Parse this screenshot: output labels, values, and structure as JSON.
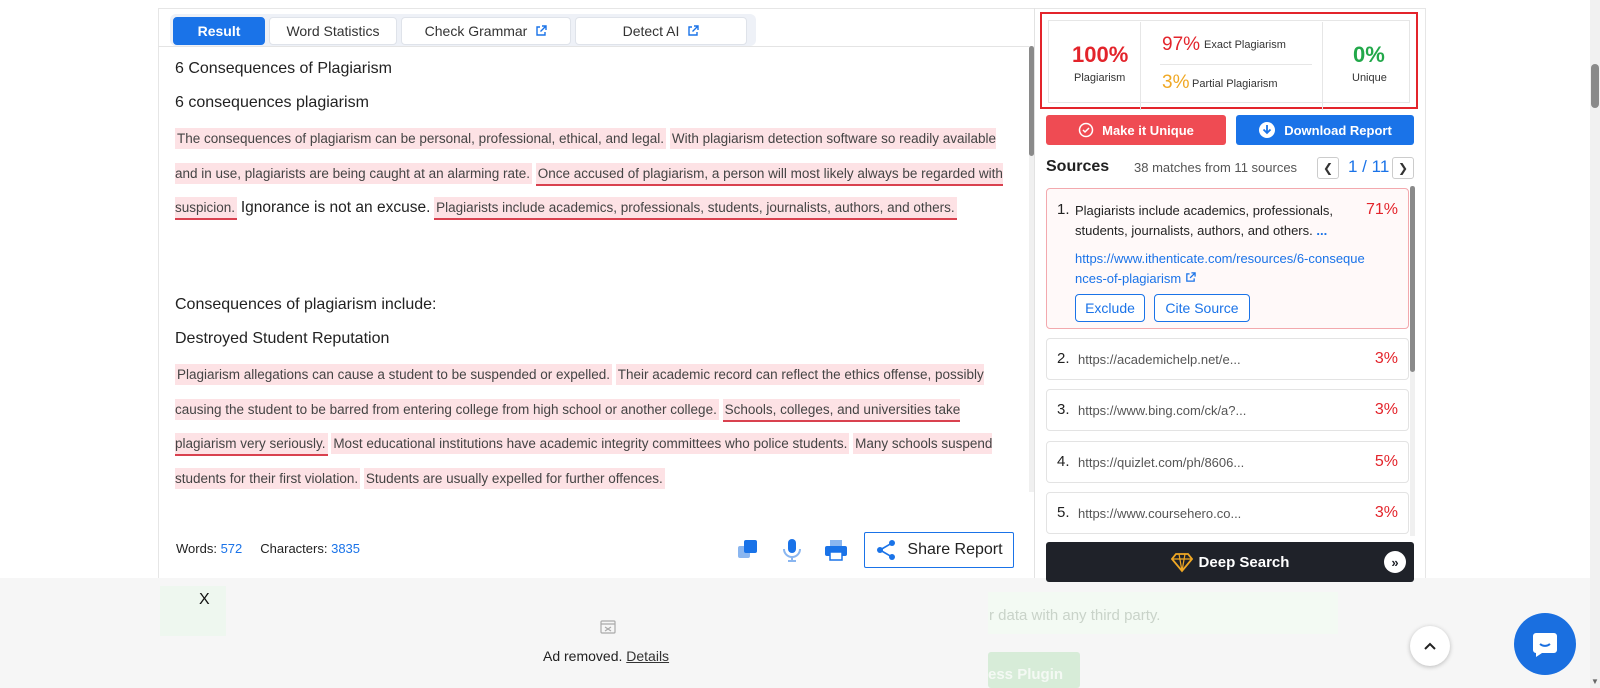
{
  "tabs": [
    {
      "label": "Result"
    },
    {
      "label": "Word Statistics"
    },
    {
      "label": "Check Grammar"
    },
    {
      "label": "Detect AI"
    }
  ],
  "content": {
    "heading1": "6 Consequences of Plagiarism",
    "heading2": "6 consequences plagiarism",
    "p1": {
      "s1": "The consequences of plagiarism can be personal, professional, ethical, and legal.",
      "s2": "With plagiarism detection software so readily available and in use, plagiarists are being caught at an alarming rate.",
      "s3": "Once accused of plagiarism, a person will most likely always be regarded with suspicion.",
      "s4": "Ignorance is not an excuse.",
      "s5": "Plagiarists include academics, professionals, students, journalists, authors, and others."
    },
    "heading3": "Consequences of plagiarism include:",
    "heading4": "Destroyed Student Reputation",
    "p2": {
      "s1": "Plagiarism allegations can cause a student to be suspended or expelled.",
      "s2": "Their academic record can reflect the ethics offense, possibly causing the student to be barred from entering college from high school or another college.",
      "s3": "Schools, colleges, and universities take plagiarism very seriously.",
      "s4": "Most educational institutions have academic integrity committees who police students.",
      "s5": "Many schools suspend students for their first violation.",
      "s6": "Students are usually expelled for further offences."
    }
  },
  "stats": {
    "words_label": "Words:",
    "words_value": "572",
    "chars_label": "Characters:",
    "chars_value": "3835"
  },
  "share_label": "Share Report",
  "summary": {
    "plagiarism_pct": "100%",
    "plagiarism_label": "Plagiarism",
    "exact_pct": "97%",
    "exact_label": "Exact Plagiarism",
    "partial_pct": "3%",
    "partial_label": "Partial Plagiarism",
    "unique_pct": "0%",
    "unique_label": "Unique"
  },
  "actions": {
    "make_unique": "Make it Unique",
    "download": "Download Report"
  },
  "sources": {
    "title": "Sources",
    "count": "38 matches from 11 sources",
    "pager": "1 / 11",
    "items": [
      {
        "num": "1.",
        "pct": "71%",
        "text": "Plagiarists include academics, professionals, students, journalists, authors, and others.",
        "dots": "...",
        "url": "https://www.ithenticate.com/resources/6-consequences-of-plagiarism",
        "exclude": "Exclude",
        "cite": "Cite Source"
      },
      {
        "num": "2.",
        "url": "https://academichelp.net/e...",
        "pct": "3%"
      },
      {
        "num": "3.",
        "url": "https://www.bing.com/ck/a?...",
        "pct": "3%"
      },
      {
        "num": "4.",
        "url": "https://quizlet.com/ph/8606...",
        "pct": "5%"
      },
      {
        "num": "5.",
        "url": "https://www.coursehero.co...",
        "pct": "3%"
      }
    ]
  },
  "deep_search": "Deep Search",
  "overlay": {
    "close": "X",
    "ad_removed": "Ad removed.",
    "details": "Details",
    "faded_text": "r data with any third party.",
    "faded_button": "ess Plugin"
  },
  "colors": {
    "accent": "#1a73e8",
    "danger": "#e3242b",
    "success": "#22a84a",
    "warning": "#f0a824",
    "highlight": "#fde2e5"
  }
}
